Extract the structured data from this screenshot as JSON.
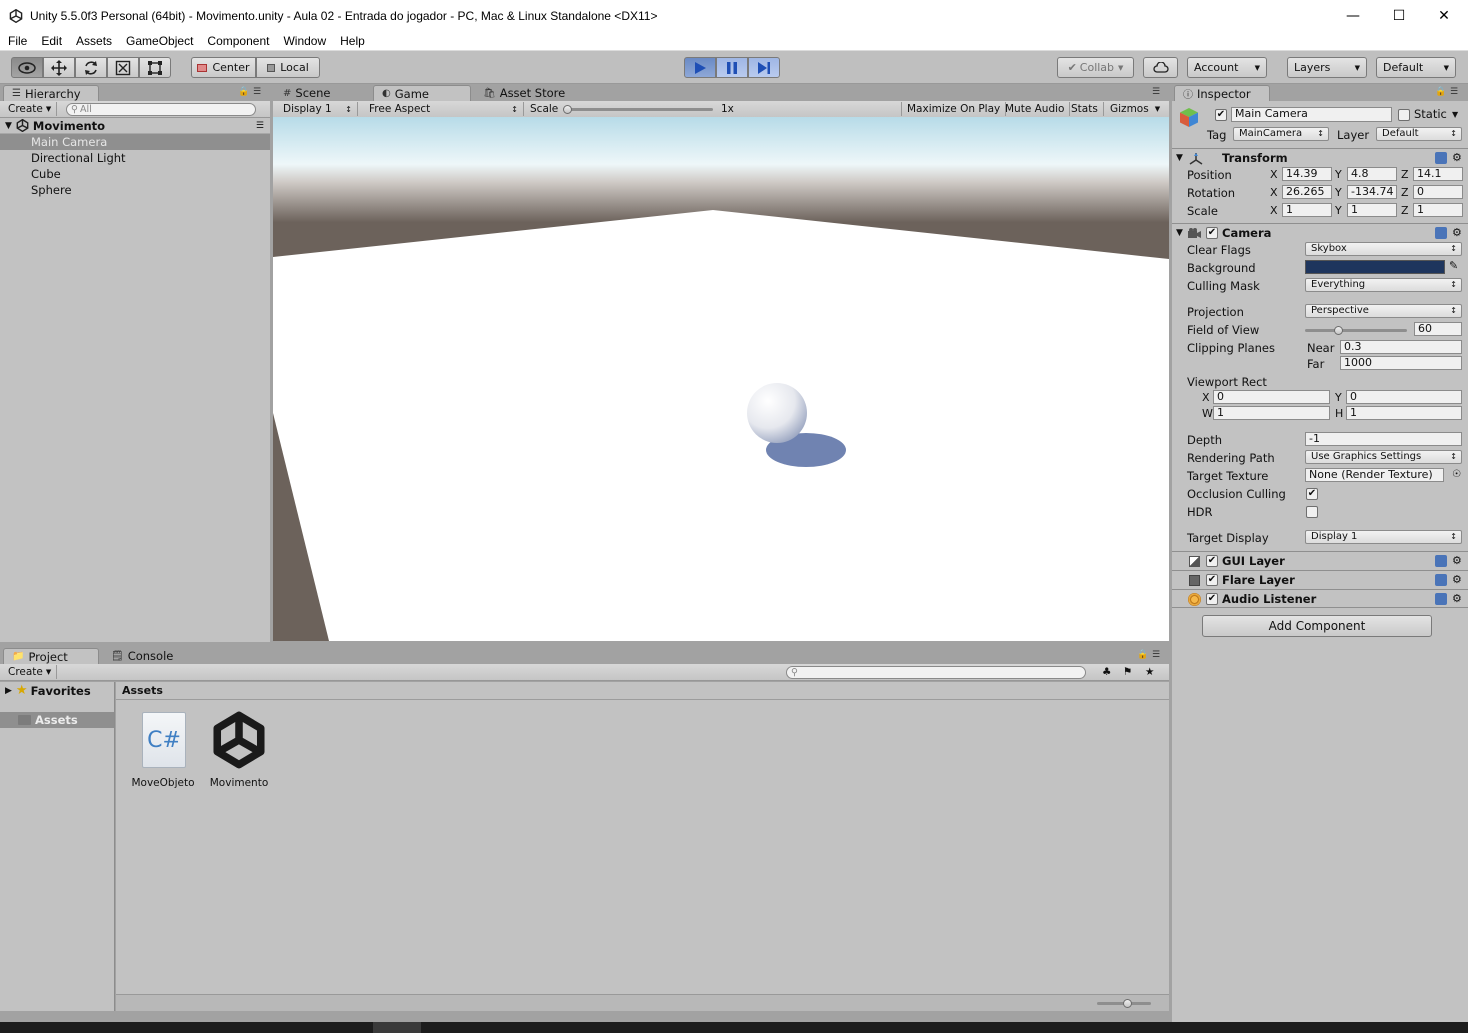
{
  "window": {
    "title": "Unity 5.5.0f3 Personal (64bit) - Movimento.unity - Aula 02 - Entrada do jogador - PC, Mac & Linux Standalone <DX11>",
    "minimize": "—",
    "maximize": "☐",
    "close": "✕"
  },
  "menu": [
    "File",
    "Edit",
    "Assets",
    "GameObject",
    "Component",
    "Window",
    "Help"
  ],
  "toolbar": {
    "center": "Center",
    "local": "Local",
    "collab": "Collab",
    "account": "Account",
    "layers": "Layers",
    "layout": "Default"
  },
  "hierarchy": {
    "tab": "Hierarchy",
    "create": "Create",
    "search_placeholder": "All",
    "scene": "Movimento",
    "items": [
      "Main Camera",
      "Directional Light",
      "Cube",
      "Sphere"
    ]
  },
  "game": {
    "tabs": [
      "Scene",
      "Game",
      "Asset Store"
    ],
    "display": "Display 1",
    "aspect": "Free Aspect",
    "scale_label": "Scale",
    "scale_value": "1x",
    "maximize": "Maximize On Play",
    "mute": "Mute Audio",
    "stats": "Stats",
    "gizmos": "Gizmos"
  },
  "project": {
    "tabs": [
      "Project",
      "Console"
    ],
    "create": "Create",
    "favorites": "Favorites",
    "assets_folder": "Assets",
    "assets_header": "Assets",
    "files": [
      {
        "name": "MoveObjeto",
        "icon": "csharp-script-icon"
      },
      {
        "name": "Movimento",
        "icon": "unity-scene-icon"
      }
    ]
  },
  "inspector": {
    "tab": "Inspector",
    "object_name": "Main Camera",
    "static": "Static",
    "tag_label": "Tag",
    "tag": "MainCamera",
    "layer_label": "Layer",
    "layer": "Default",
    "transform": {
      "title": "Transform",
      "position_label": "Position",
      "position": [
        "14.39",
        "4.8",
        "14.1"
      ],
      "rotation_label": "Rotation",
      "rotation": [
        "26.265",
        "-134.74",
        "0"
      ],
      "scale_label": "Scale",
      "scale": [
        "1",
        "1",
        "1"
      ],
      "axes": [
        "X",
        "Y",
        "Z"
      ]
    },
    "camera": {
      "title": "Camera",
      "clear_flags_label": "Clear Flags",
      "clear_flags": "Skybox",
      "background_label": "Background",
      "background_color": "#1e355d",
      "culling_mask_label": "Culling Mask",
      "culling_mask": "Everything",
      "projection_label": "Projection",
      "projection": "Perspective",
      "fov_label": "Field of View",
      "fov": "60",
      "fov_range": [
        1,
        179
      ],
      "clipping_label": "Clipping Planes",
      "near_label": "Near",
      "near": "0.3",
      "far_label": "Far",
      "far": "1000",
      "viewport_label": "Viewport Rect",
      "vx_label": "X",
      "vx": "0",
      "vy_label": "Y",
      "vy": "0",
      "vw_label": "W",
      "vw": "1",
      "vh_label": "H",
      "vh": "1",
      "depth_label": "Depth",
      "depth": "-1",
      "rendering_label": "Rendering Path",
      "rendering": "Use Graphics Settings",
      "target_texture_label": "Target Texture",
      "target_texture": "None (Render Texture)",
      "occlusion_label": "Occlusion Culling",
      "hdr_label": "HDR",
      "target_display_label": "Target Display",
      "target_display": "Display 1"
    },
    "gui_layer": "GUI Layer",
    "flare_layer": "Flare Layer",
    "audio_listener": "Audio Listener",
    "add_component": "Add Component"
  }
}
